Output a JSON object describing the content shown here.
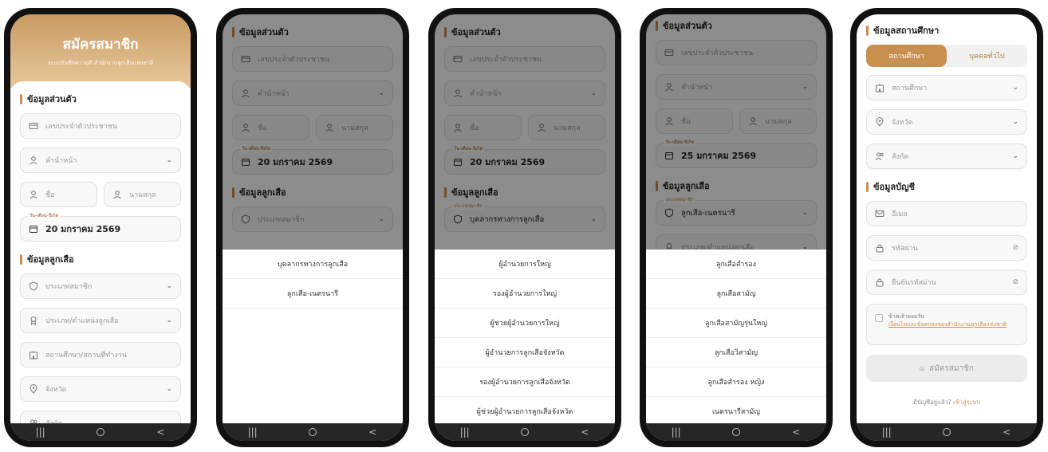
{
  "screen1": {
    "title": "สมัครสมาชิก",
    "subtitle": "ระบบบันทึกความดี สำนักงานลูกเสือแห่งชาติ",
    "section_personal": "ข้อมูลส่วนตัว",
    "citizen_id_placeholder": "เลขประจำตัวประชาชน",
    "prefix_placeholder": "คำนำหน้า",
    "first_name_placeholder": "ชื่อ",
    "last_name_placeholder": "นามสกุล",
    "birthdate_label": "วัน-เดือน-ปีเกิด",
    "birthdate_value": "20 มกราคม 2569",
    "section_scout": "ข้อมูลลูกเสือ",
    "member_type_placeholder": "ประเภทสมาชิก",
    "scout_position_placeholder": "ประเภท/ตำแหน่งลูกเสือ",
    "workplace_placeholder": "สถานศึกษา/สถานที่ทำงาน",
    "province_placeholder": "จังหวัด",
    "affiliation_placeholder": "สังกัด"
  },
  "screen2": {
    "section_personal": "ข้อมูลส่วนตัว",
    "citizen_id_placeholder": "เลขประจำตัวประชาชน",
    "prefix_placeholder": "คำนำหน้า",
    "first_name_placeholder": "ชื่อ",
    "last_name_placeholder": "นามสกุล",
    "birthdate_label": "วัน-เดือน-ปีเกิด",
    "birthdate_value": "20 มกราคม 2569",
    "section_scout": "ข้อมูลลูกเสือ",
    "member_type_placeholder": "ประเภทสมาชิก",
    "options": [
      "บุคลากรทางการลูกเสือ",
      "ลูกเสือ-เนตรนารี"
    ]
  },
  "screen3": {
    "section_personal": "ข้อมูลส่วนตัว",
    "citizen_id_placeholder": "เลขประจำตัวประชาชน",
    "prefix_placeholder": "คำนำหน้า",
    "first_name_placeholder": "ชื่อ",
    "last_name_placeholder": "นามสกุล",
    "birthdate_label": "วัน-เดือน-ปีเกิด",
    "birthdate_value": "20 มกราคม 2569",
    "section_scout": "ข้อมูลลูกเสือ",
    "member_type_label": "ประเภทสมาชิก",
    "member_type_value": "บุคลากรทางการลูกเสือ",
    "options": [
      "ผู้อำนวยการใหญ่",
      "รองผู้อำนวยการใหญ่",
      "ผู้ช่วยผู้อำนวยการใหญ่",
      "ผู้อำนวยการลูกเสือจังหวัด",
      "รองผู้อำนวยการลูกเสือจังหวัด",
      "ผู้ช่วยผู้อำนวยการลูกเสือจังหวัด"
    ]
  },
  "screen4": {
    "section_personal": "ข้อมูลส่วนตัว",
    "citizen_id_placeholder": "เลขประจำตัวประชาชน",
    "prefix_placeholder": "คำนำหน้า",
    "first_name_placeholder": "ชื่อ",
    "last_name_placeholder": "นามสกุล",
    "birthdate_label": "วัน-เดือน-ปีเกิด",
    "birthdate_value": "25 มกราคม 2569",
    "section_scout": "ข้อมูลลูกเสือ",
    "member_type_label": "ประเภทสมาชิก",
    "member_type_value": "ลูกเสือ-เนตรนารี",
    "scout_position_placeholder": "ประเภท/ตำแหน่งลูกเสือ",
    "options": [
      "ลูกเสือสำรอง",
      "ลูกเสือสามัญ",
      "ลูกเสือสามัญรุ่นใหญ่",
      "ลูกเสือวิสามัญ",
      "ลูกเสือสำรอง หญิง",
      "เนตรนารีสามัญ"
    ]
  },
  "screen5": {
    "section_school": "ข้อมูลสถานศึกษา",
    "tab_school": "สถานศึกษา",
    "tab_general": "บุคคลทั่วไป",
    "school_placeholder": "สถานศึกษา",
    "province_placeholder": "จังหวัด",
    "affiliation_placeholder": "สังกัด",
    "section_account": "ข้อมูลบัญชี",
    "email_placeholder": "อีเมล",
    "password_placeholder": "รหัสผ่าน",
    "confirm_password_placeholder": "ยืนยันรหัสผ่าน",
    "accept_label": "ข้าพเจ้ายอมรับ",
    "terms_link": "เงื่อนไขและข้อตกลงของสำนักงานลูกเสือแห่งชาติ",
    "submit_label": "สมัครสมาชิก",
    "have_account": "มีบัญชีอยู่แล้ว?",
    "login_link": "เข้าสู่ระบบ"
  },
  "icons": [
    "id-card-icon",
    "user-icon",
    "calendar-icon",
    "shield-icon",
    "badge-icon",
    "building-icon",
    "location-icon",
    "group-icon",
    "mail-icon",
    "lock-icon",
    "eye-off-icon",
    "chevron-down-icon",
    "add-user-icon"
  ],
  "colors": {
    "accent": "#c8904e",
    "header_top": "#c99a62",
    "header_bottom": "#e8c89d",
    "nav_bar": "#262626"
  }
}
